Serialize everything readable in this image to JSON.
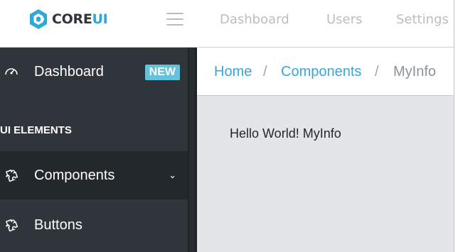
{
  "brand": {
    "prefix": "CORE",
    "suffix": "UI",
    "accent_color": "#2da8d8"
  },
  "header": {
    "nav": [
      {
        "label": "Dashboard"
      },
      {
        "label": "Users"
      },
      {
        "label": "Settings"
      }
    ]
  },
  "sidebar": {
    "items": [
      {
        "label": "Dashboard",
        "icon": "speedometer-icon",
        "badge": "NEW",
        "badge_color": "#63c2de"
      },
      {
        "label": "Components",
        "icon": "puzzle-icon",
        "has_submenu": true
      },
      {
        "label": "Buttons",
        "icon": "puzzle-icon"
      }
    ],
    "section_title": "UI ELEMENTS"
  },
  "breadcrumb": {
    "items": [
      "Home",
      "Components",
      "MyInfo"
    ],
    "separator": "/"
  },
  "main": {
    "text": "Hello World! MyInfo"
  },
  "colors": {
    "sidebar_bg": "#2f353a",
    "main_bg": "#e4e5e6",
    "link": "#3aa6d6"
  }
}
